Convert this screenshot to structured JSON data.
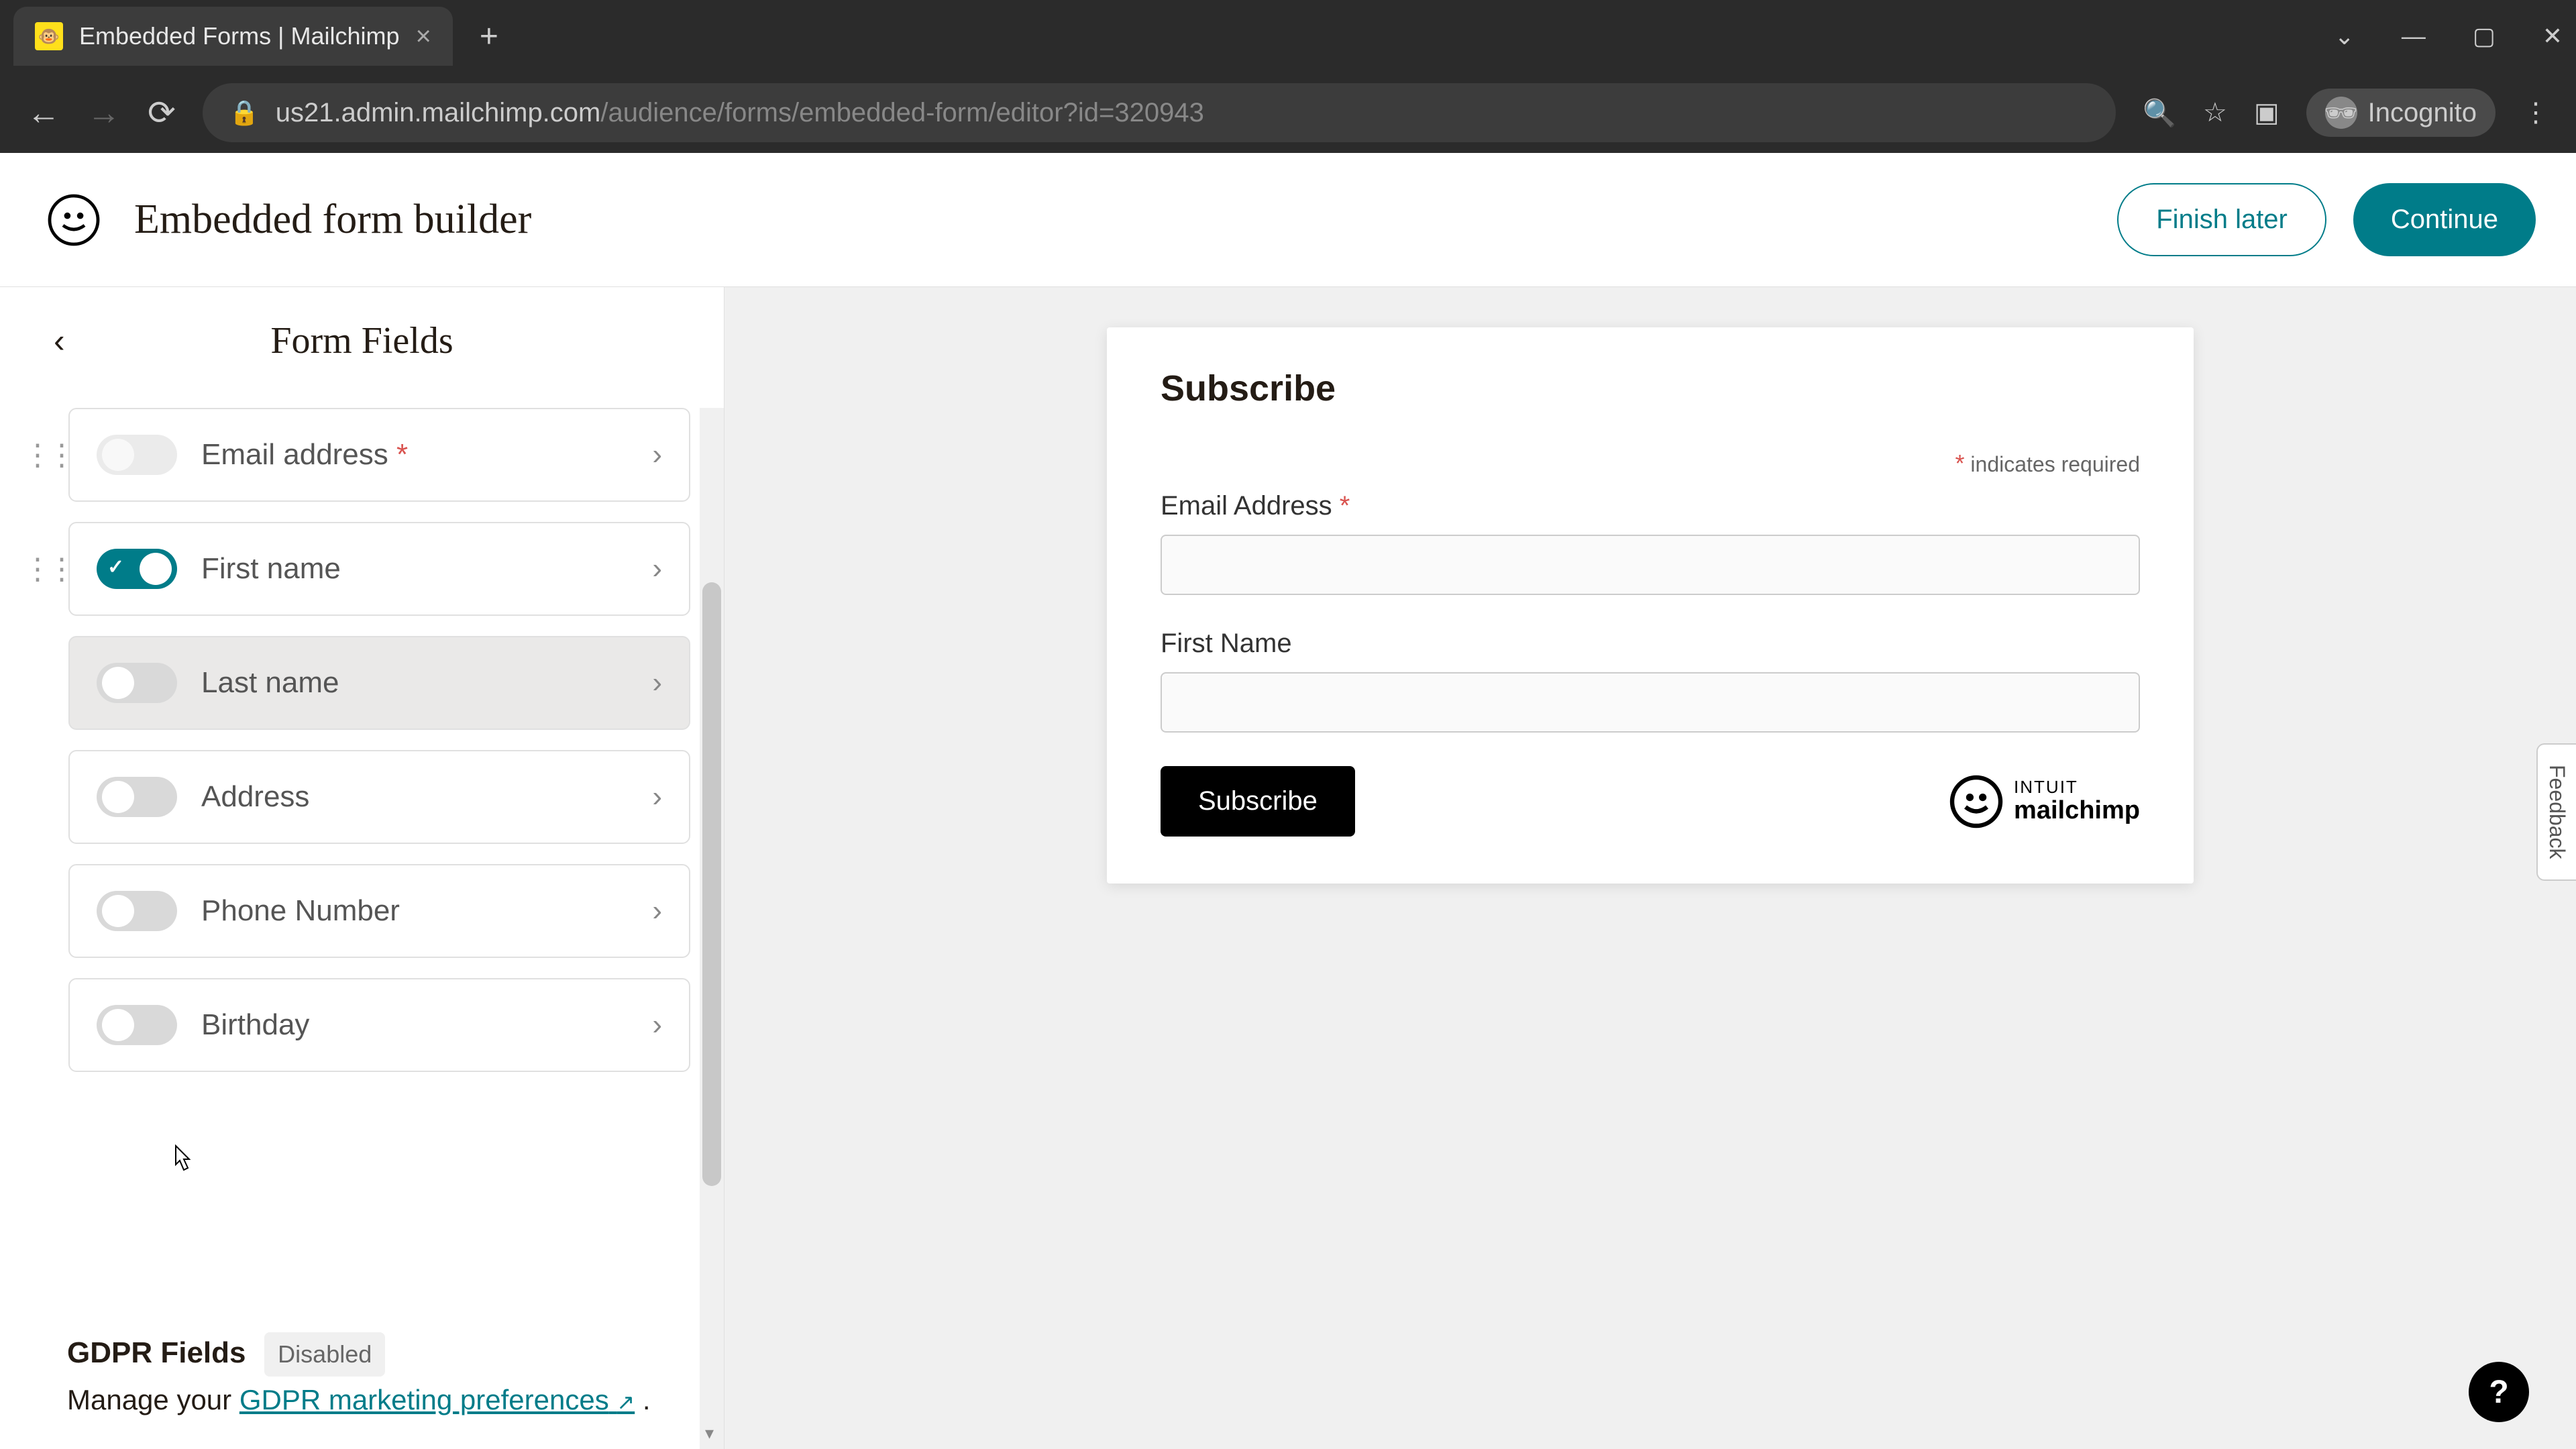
{
  "browser": {
    "tab_title": "Embedded Forms | Mailchimp",
    "url_domain": "us21.admin.mailchimp.com",
    "url_path": "/audience/forms/embedded-form/editor?id=320943",
    "incognito_label": "Incognito"
  },
  "header": {
    "title": "Embedded form builder",
    "finish_later": "Finish later",
    "continue": "Continue"
  },
  "sidebar": {
    "title": "Form Fields",
    "fields": [
      {
        "label": "Email address",
        "required": true,
        "enabled": true,
        "locked": true,
        "has_handle": true
      },
      {
        "label": "First name",
        "required": false,
        "enabled": true,
        "locked": false,
        "has_handle": true
      },
      {
        "label": "Last name",
        "required": false,
        "enabled": false,
        "locked": false,
        "has_handle": false,
        "hovered": true
      },
      {
        "label": "Address",
        "required": false,
        "enabled": false,
        "locked": false,
        "has_handle": false
      },
      {
        "label": "Phone Number",
        "required": false,
        "enabled": false,
        "locked": false,
        "has_handle": false
      },
      {
        "label": "Birthday",
        "required": false,
        "enabled": false,
        "locked": false,
        "has_handle": false
      }
    ],
    "gdpr": {
      "title": "GDPR Fields",
      "badge": "Disabled",
      "manage_text": "Manage your ",
      "link_text": "GDPR marketing preferences",
      "period": " ."
    }
  },
  "preview": {
    "form_title": "Subscribe",
    "required_note": "indicates required",
    "fields": [
      {
        "label": "Email Address",
        "required": true
      },
      {
        "label": "First Name",
        "required": false
      }
    ],
    "subscribe_button": "Subscribe",
    "badge_intuit": "INTUIT",
    "badge_mailchimp": "mailchimp"
  },
  "feedback_label": "Feedback",
  "help_label": "?"
}
